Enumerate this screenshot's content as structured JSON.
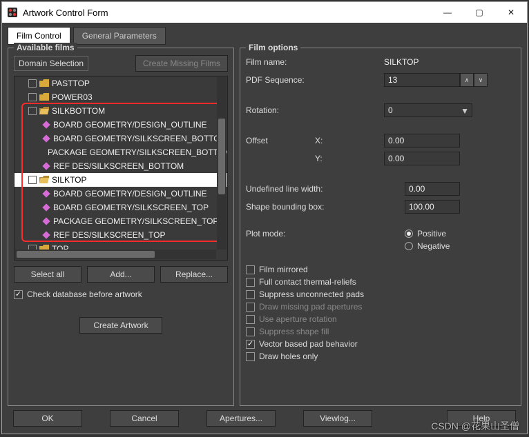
{
  "window": {
    "title": "Artwork Control Form"
  },
  "winbtns": {
    "min": "—",
    "max": "▢",
    "close": "✕"
  },
  "tabs": {
    "film_control": "Film Control",
    "general_params": "General Parameters"
  },
  "left": {
    "group_title": "Available films",
    "domain_selection": "Domain Selection",
    "create_missing": "Create Missing Films",
    "tree": [
      {
        "type": "folder",
        "label": "PASTTOP",
        "indent": 0,
        "chk": true
      },
      {
        "type": "folder",
        "label": "POWER03",
        "indent": 0,
        "chk": true
      },
      {
        "type": "folder-open",
        "label": "SILKBOTTOM",
        "indent": 0,
        "chk": true
      },
      {
        "type": "leaf",
        "label": "BOARD GEOMETRY/DESIGN_OUTLINE",
        "indent": 1
      },
      {
        "type": "leaf",
        "label": "BOARD GEOMETRY/SILKSCREEN_BOTTOM",
        "indent": 1
      },
      {
        "type": "leaf",
        "label": "PACKAGE GEOMETRY/SILKSCREEN_BOTTOM",
        "indent": 1
      },
      {
        "type": "leaf",
        "label": "REF DES/SILKSCREEN_BOTTOM",
        "indent": 1
      },
      {
        "type": "folder-open",
        "label": "SILKTOP",
        "indent": 0,
        "chk": true,
        "selected": true
      },
      {
        "type": "leaf",
        "label": "BOARD GEOMETRY/DESIGN_OUTLINE",
        "indent": 1
      },
      {
        "type": "leaf",
        "label": "BOARD GEOMETRY/SILKSCREEN_TOP",
        "indent": 1
      },
      {
        "type": "leaf",
        "label": "PACKAGE GEOMETRY/SILKSCREEN_TOP",
        "indent": 1
      },
      {
        "type": "leaf",
        "label": "REF DES/SILKSCREEN_TOP",
        "indent": 1
      },
      {
        "type": "folder",
        "label": "TOP",
        "indent": 0,
        "chk": true
      }
    ],
    "select_all": "Select all",
    "add": "Add...",
    "replace": "Replace...",
    "check_db": "Check database before artwork",
    "create_artwork": "Create Artwork"
  },
  "right": {
    "group_title": "Film options",
    "film_name_lbl": "Film name:",
    "film_name_val": "SILKTOP",
    "pdf_seq_lbl": "PDF Sequence:",
    "pdf_seq_val": "13",
    "rotation_lbl": "Rotation:",
    "rotation_val": "0",
    "offset_lbl": "Offset",
    "offset_x_lbl": "X:",
    "offset_x_val": "0.00",
    "offset_y_lbl": "Y:",
    "offset_y_val": "0.00",
    "undef_lw_lbl": "Undefined line width:",
    "undef_lw_val": "0.00",
    "shape_bb_lbl": "Shape bounding box:",
    "shape_bb_val": "100.00",
    "plot_mode_lbl": "Plot mode:",
    "plot_positive": "Positive",
    "plot_negative": "Negative",
    "opts": {
      "film_mirrored": "Film mirrored",
      "full_contact": "Full contact thermal-reliefs",
      "suppress_unconn": "Suppress unconnected pads",
      "draw_missing": "Draw missing pad apertures",
      "use_aperture": "Use aperture rotation",
      "suppress_shape": "Suppress shape fill",
      "vector_pad": "Vector based pad behavior",
      "draw_holes": "Draw holes only"
    }
  },
  "footer": {
    "ok": "OK",
    "cancel": "Cancel",
    "apertures": "Apertures...",
    "viewlog": "Viewlog...",
    "help": "Help"
  },
  "watermark": "CSDN @花果山圣僧"
}
